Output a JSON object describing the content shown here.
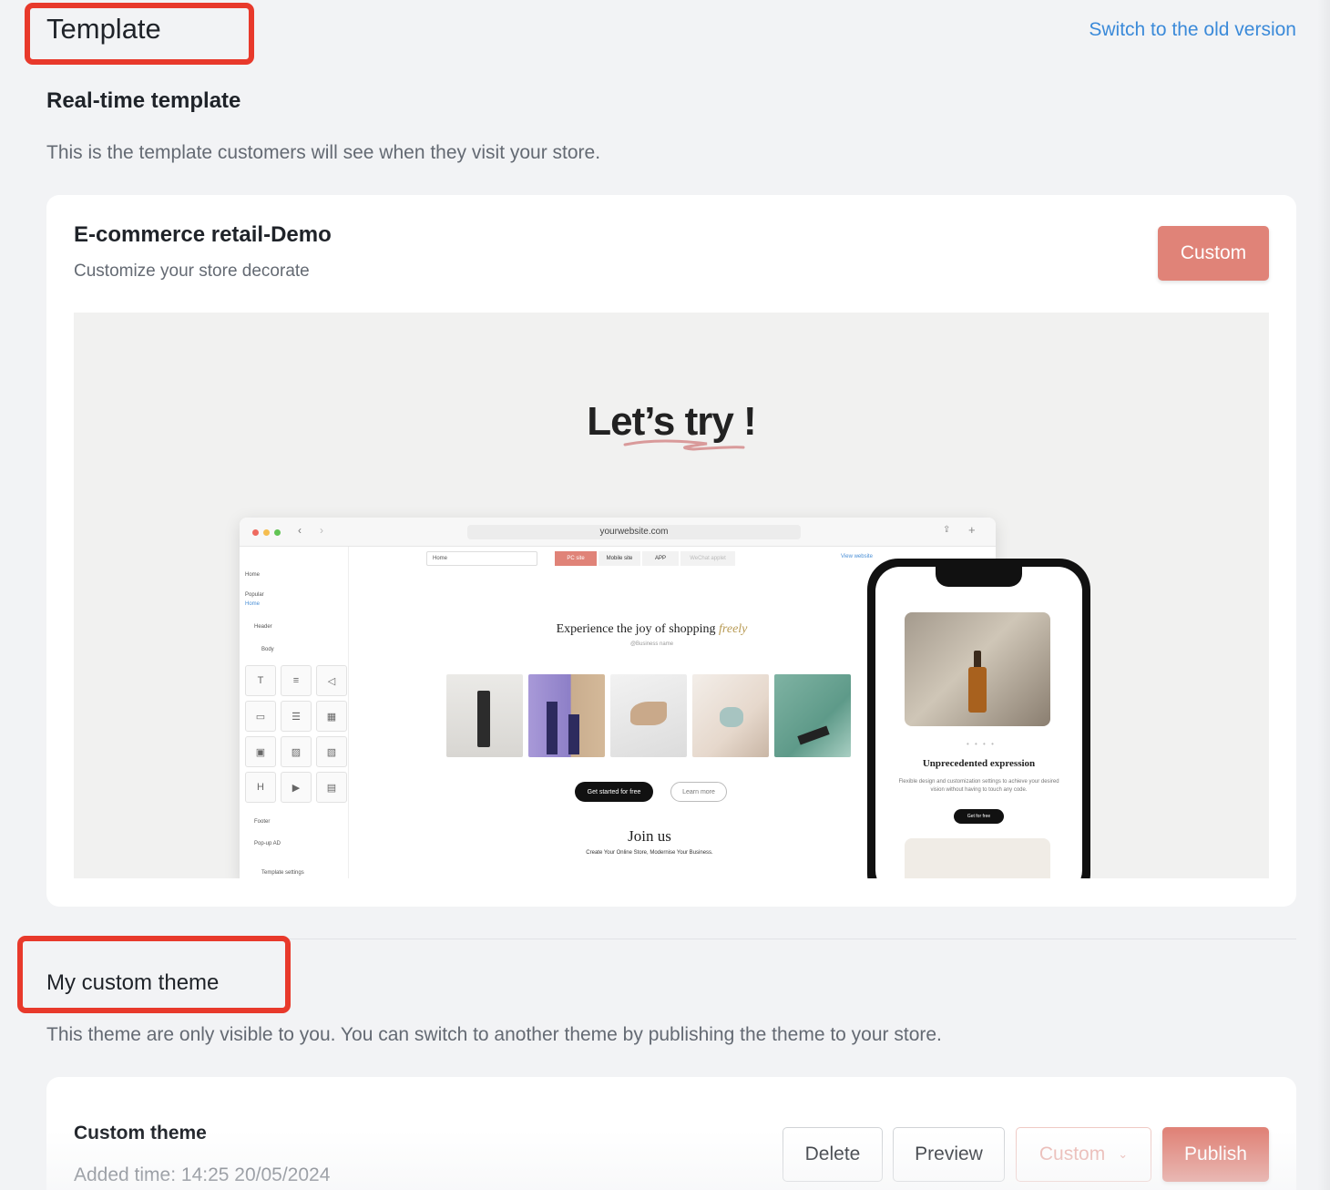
{
  "header": {
    "title": "Template",
    "switch_link": "Switch to the old version"
  },
  "realtime": {
    "heading": "Real-time template",
    "description": "This is the template customers will see when they visit your store."
  },
  "template_card": {
    "title": "E-commerce retail-Demo",
    "subtitle": "Customize your store decorate",
    "custom_button": "Custom",
    "preview": {
      "headline": "Let’s try !",
      "browser": {
        "url": "yourwebsite.com",
        "page_select": "Home",
        "tabs": [
          "PC site",
          "Mobile site",
          "APP",
          "WeChat applet"
        ],
        "view_link": "View website",
        "sidebar": {
          "home": "Home",
          "popular": "Popular",
          "home_link": "Home",
          "header": "Header",
          "body": "Body",
          "footer": "Footer",
          "popup": "Pop-up AD",
          "settings": "Template settings"
        },
        "tools": [
          "Title",
          "Text",
          "Announcement",
          "Banner Slider",
          "Icon List",
          "Promotion Grid",
          "Product List",
          "Photo",
          "Image with text",
          "Divider",
          "Video",
          "Form"
        ],
        "hero_title": "Experience the joy of shopping",
        "hero_accent": "freely",
        "business_name": "@Business name",
        "cta_primary": "Get started for free",
        "cta_secondary": "Learn more",
        "join_title": "Join us",
        "join_sub": "Create Your Online Store, Modernise Your Business."
      },
      "phone": {
        "title": "Unprecedented expression",
        "text": "Flexible design and customization settings to achieve your desired vision without having to touch any code.",
        "button": "Get for free"
      }
    }
  },
  "my_theme": {
    "heading": "My custom theme",
    "description": "This theme are only visible to you. You can switch to another theme by publishing the theme to your store."
  },
  "theme_card": {
    "title": "Custom theme",
    "added_time": "Added time: 14:25 20/05/2024",
    "buttons": {
      "delete": "Delete",
      "preview": "Preview",
      "custom": "Custom",
      "publish": "Publish"
    }
  },
  "colors": {
    "accent": "#e08378",
    "link": "#3b8ad9",
    "highlight_box": "#e8392b",
    "background": "#f2f3f5"
  }
}
